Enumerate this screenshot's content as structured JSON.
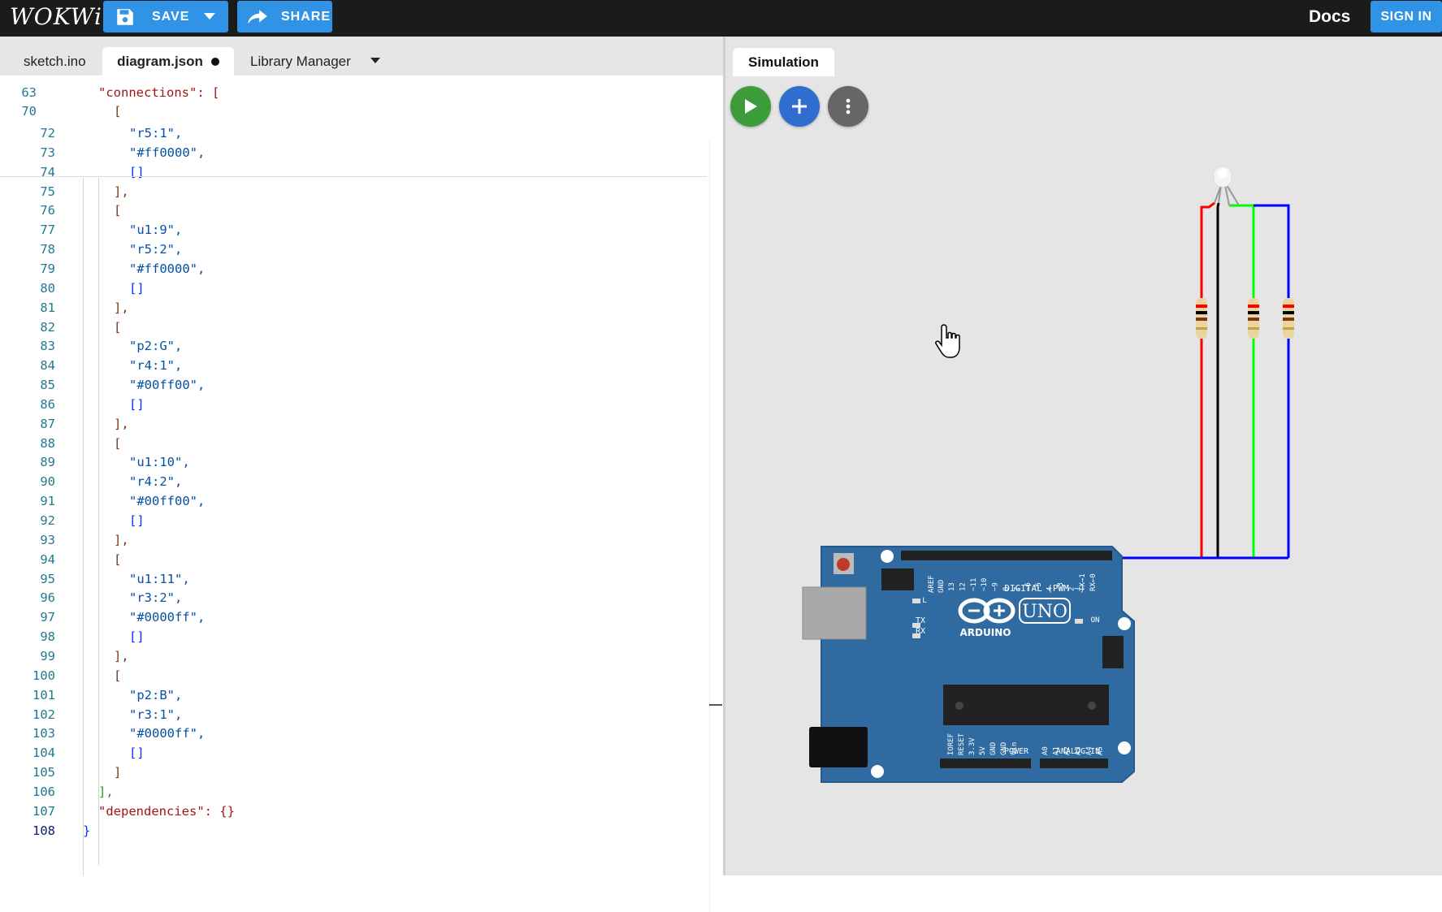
{
  "topbar": {
    "logo": "WOKWi",
    "save_label": "SAVE",
    "share_label": "SHARE",
    "docs_label": "Docs",
    "signin_label": "SIGN IN"
  },
  "editor": {
    "tabs": [
      {
        "label": "sketch.ino"
      },
      {
        "label": "diagram.json",
        "modified": true
      },
      {
        "label": "Library Manager"
      }
    ],
    "sticky_lines": [
      {
        "num": "63",
        "text": "\"connections\": ["
      },
      {
        "num": "70",
        "text": "["
      }
    ],
    "lines": [
      {
        "num": "72",
        "text": "\"r5:1\","
      },
      {
        "num": "73",
        "text": "\"#ff0000\","
      },
      {
        "num": "74",
        "text": "[]"
      },
      {
        "num": "75",
        "text": "],"
      },
      {
        "num": "76",
        "text": "["
      },
      {
        "num": "77",
        "text": "\"u1:9\","
      },
      {
        "num": "78",
        "text": "\"r5:2\","
      },
      {
        "num": "79",
        "text": "\"#ff0000\","
      },
      {
        "num": "80",
        "text": "[]"
      },
      {
        "num": "81",
        "text": "],"
      },
      {
        "num": "82",
        "text": "["
      },
      {
        "num": "83",
        "text": "\"p2:G\","
      },
      {
        "num": "84",
        "text": "\"r4:1\","
      },
      {
        "num": "85",
        "text": "\"#00ff00\","
      },
      {
        "num": "86",
        "text": "[]"
      },
      {
        "num": "87",
        "text": "],"
      },
      {
        "num": "88",
        "text": "["
      },
      {
        "num": "89",
        "text": "\"u1:10\","
      },
      {
        "num": "90",
        "text": "\"r4:2\","
      },
      {
        "num": "91",
        "text": "\"#00ff00\","
      },
      {
        "num": "92",
        "text": "[]"
      },
      {
        "num": "93",
        "text": "],"
      },
      {
        "num": "94",
        "text": "["
      },
      {
        "num": "95",
        "text": "\"u1:11\","
      },
      {
        "num": "96",
        "text": "\"r3:2\","
      },
      {
        "num": "97",
        "text": "\"#0000ff\","
      },
      {
        "num": "98",
        "text": "[]"
      },
      {
        "num": "99",
        "text": "],"
      },
      {
        "num": "100",
        "text": "["
      },
      {
        "num": "101",
        "text": "\"p2:B\","
      },
      {
        "num": "102",
        "text": "\"r3:1\","
      },
      {
        "num": "103",
        "text": "\"#0000ff\","
      },
      {
        "num": "104",
        "text": "[]"
      },
      {
        "num": "105",
        "text": "]"
      },
      {
        "num": "106",
        "text": "],"
      },
      {
        "num": "107",
        "text": "\"dependencies\": {}"
      },
      {
        "num": "108",
        "text": "}"
      }
    ]
  },
  "simulation": {
    "tab_label": "Simulation",
    "board": {
      "logo_text": "ARDUINO",
      "model": "UNO",
      "digital_label": "DIGITAL (PWM ~)",
      "power_label": "POWER",
      "analog_label": "ANALOG IN",
      "tx": "TX",
      "rx": "RX",
      "on": "ON",
      "l": "L",
      "aref": "AREF",
      "gnd": "GND",
      "digital_pins": [
        "13",
        "12",
        "~11",
        "~10",
        "~9",
        "8",
        "7",
        "~6",
        "~5",
        "4",
        "~3",
        "2",
        "TX→1",
        "RX←0"
      ],
      "power_pins": [
        "IOREF",
        "RESET",
        "3.3V",
        "5V",
        "GND",
        "GND",
        "Vin"
      ],
      "analog_pins": [
        "A0",
        "A1",
        "A2",
        "A3",
        "A4",
        "A5"
      ]
    },
    "wire_colors": {
      "red": "#ff0000",
      "black": "#000000",
      "green": "#00ff00",
      "blue": "#0000ff"
    }
  }
}
